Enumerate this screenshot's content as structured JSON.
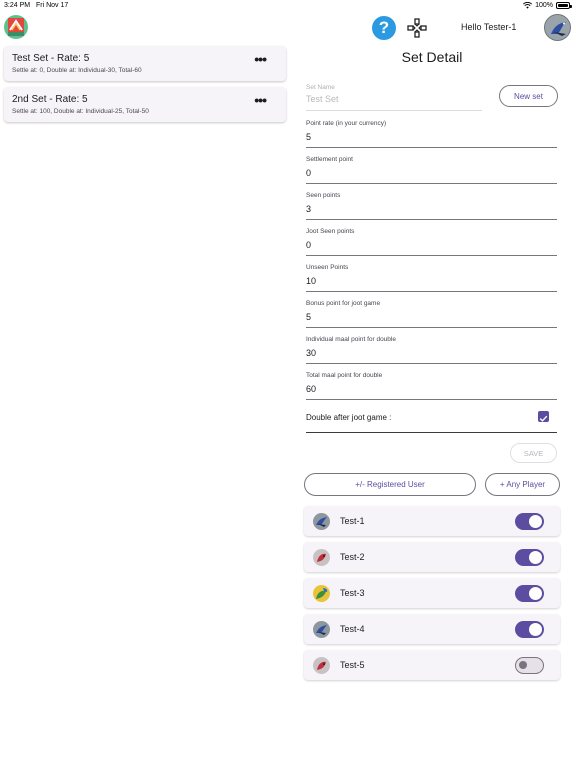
{
  "status_bar": {
    "time": "3:24 PM",
    "date": "Fri Nov 17",
    "battery": "100%"
  },
  "header": {
    "greeting": "Hello Tester-1"
  },
  "sets": [
    {
      "title": "Test Set - Rate: 5",
      "subtitle": "Settle at: 0, Double at: Individual-30, Total-60",
      "menu": "•••"
    },
    {
      "title": "2nd Set - Rate: 5",
      "subtitle": "Settle at: 100, Double at: Individual-25, Total-50",
      "menu": "•••"
    }
  ],
  "detail": {
    "title": "Set Detail",
    "new_set_label": "New set",
    "set_name": {
      "label": "Set Name",
      "placeholder": "Test Set"
    },
    "fields": [
      {
        "label": "Point rate (in your currency)",
        "value": "5"
      },
      {
        "label": "Settlement point",
        "value": "0"
      },
      {
        "label": "Seen points",
        "value": "3"
      },
      {
        "label": "Joot Seen points",
        "value": "0"
      },
      {
        "label": "Unseen Points",
        "value": "10"
      },
      {
        "label": "Bonus point for joot game",
        "value": "5"
      },
      {
        "label": "Individual maal point for double",
        "value": "30"
      },
      {
        "label": "Total maal point for double",
        "value": "60"
      }
    ],
    "double_after_joot": {
      "label": "Double after joot game :",
      "checked": true
    },
    "save_label": "SAVE"
  },
  "player_actions": {
    "registered_user_label": "+/- Registered User",
    "any_player_label": "+ Any Player"
  },
  "players": [
    {
      "name": "Test-1",
      "enabled": true,
      "avatar": "bird-avatar"
    },
    {
      "name": "Test-2",
      "enabled": true,
      "avatar": "red-bird-avatar"
    },
    {
      "name": "Test-3",
      "enabled": true,
      "avatar": "parrot-avatar"
    },
    {
      "name": "Test-4",
      "enabled": true,
      "avatar": "bird-avatar"
    },
    {
      "name": "Test-5",
      "enabled": false,
      "avatar": "red-bird-avatar"
    }
  ],
  "colors": {
    "accent": "#5b4da0",
    "help": "#2b9ae0",
    "card_bg": "#f6f4f8"
  }
}
